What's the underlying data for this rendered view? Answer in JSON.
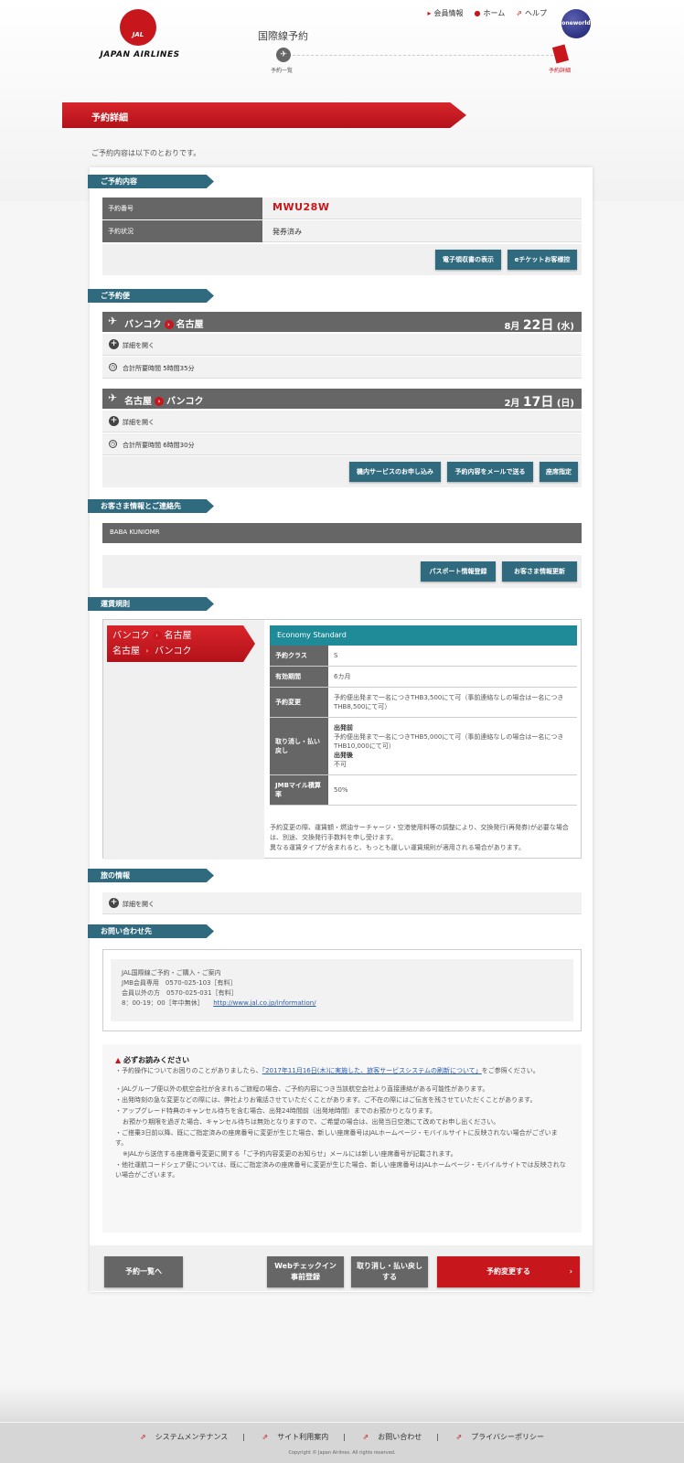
{
  "header": {
    "brand": "JAPAN AIRLINES",
    "brand_mark": "JAL",
    "links": [
      "会員情報",
      "ホーム",
      "ヘルプ"
    ],
    "oneworld": "oneworld",
    "nav_title": "国際線予約",
    "step1_label": "予約一覧",
    "step2_label": "予約詳細"
  },
  "page": {
    "title": "予約詳細",
    "intro": "ご予約内容は以下のとおりです。"
  },
  "reservation": {
    "section": "ご予約内容",
    "rows": [
      {
        "label": "予約番号",
        "value": "MWU28W"
      },
      {
        "label": "予約状況",
        "value": "発券済み"
      }
    ],
    "btn_receipt": "電子領収書の表示",
    "btn_eticket": "eチケットお客様控"
  },
  "flights": {
    "section": "ご予約便",
    "items": [
      {
        "from": "バンコク",
        "to": "名古屋",
        "month": "8月",
        "day": "22日",
        "dow": "(水)",
        "details": "詳細を開く",
        "duration": "合計所要時間 5時間35分"
      },
      {
        "from": "名古屋",
        "to": "バンコク",
        "month": "2月",
        "day": "17日",
        "dow": "(日)",
        "details": "詳細を開く",
        "duration": "合計所要時間 6時間30分"
      }
    ],
    "btn_service": "機内サービスのお申し込み",
    "btn_mail": "予約内容をメールで送る",
    "btn_seat": "座席指定"
  },
  "passenger": {
    "section": "お客さま情報とご連絡先",
    "name": "BABA KUNIOMR",
    "btn_passport": "パスポート情報登録",
    "btn_update": "お客さま情報更新"
  },
  "fare": {
    "section": "運賃規則",
    "route1_from": "バンコク",
    "route1_to": "名古屋",
    "route2_from": "名古屋",
    "route2_to": "バンコク",
    "fare_name": "Economy Standard",
    "rows": [
      {
        "k": "予約クラス",
        "v": "S"
      },
      {
        "k": "有効期間",
        "v": "6カ月"
      },
      {
        "k": "予約変更",
        "v": "予約便出発まで一名につきTHB3,500にて可（事前連絡なしの場合は一名につきTHB8,500にて可）"
      },
      {
        "k": "JMBマイル積算率",
        "v": "50%"
      }
    ],
    "cancel_k": "取り消し・払い戻し",
    "cancel_before_h": "出発前",
    "cancel_before": "予約便出発まで一名につきTHB5,000にて可（事前連絡なしの場合は一名につきTHB10,000にて可）",
    "cancel_after_h": "出発後",
    "cancel_after": "不可",
    "note1": "予約変更の際、運賃額・燃油サーチャージ・空港使用料等の調整により、交換発行(再発券)が必要な場合は、別途、交換発行手数料を申し受けます。",
    "note2": "異なる運賃タイプが含まれると、もっとも厳しい運賃規則が適用される場合があります。"
  },
  "travel": {
    "section": "旅の情報",
    "details": "詳細を開く"
  },
  "inquiry": {
    "section": "お問い合わせ先",
    "line1": "JAL国際線ご予約・ご購入・ご案内",
    "line2": "JMB会員専用　0570-025-103［有料］",
    "line3": "会員以外の方　0570-025-031［有料］",
    "hours": "8：00-19：00［年中無休］",
    "url": "http://www.jal.co.jp/information/"
  },
  "notice": {
    "title": "必ずお読みください",
    "p1a": "・予約操作についてお困りのことがありましたら、",
    "p1link": "「2017年11月16日(木)に実施した、旅客サービスシステムの刷新について」",
    "p1b": "をご参照ください。",
    "p2": "・JALグループ便以外の航空会社が含まれるご旅程の場合、ご予約内容につき当該航空会社より直接連絡がある可能性があります。",
    "p3": "・出発時刻の急な変更などの際には、弊社よりお電話させていただくことがあります。ご不在の際にはご伝言を残させていただくことがあります。",
    "p4": "・アップグレード特典のキャンセル待ちを含む場合、出発24時間前（出発地時間）までのお預かりとなります。",
    "p4b": "お預かり期限を過ぎた場合、キャンセル待ちは無効となりますので、ご希望の場合は、出発当日空港にて改めてお申し出ください。",
    "p5": "・ご搭乗3日前以降、既にご指定済みの座席番号に変更が生じた場合、新しい座席番号はJALホームページ・モバイルサイトに反映されない場合がございます。",
    "p5b": "※JALから送信する座席番号変更に関する「ご予約内容変更のお知らせ」メールには新しい座席番号が記載されます。",
    "p6": "・他社運航コードシェア便については、既にご指定済みの座席番号に変更が生じた場合、新しい座席番号はJALホームページ・モバイルサイトでは反映されない場合がございます。"
  },
  "actions": {
    "back": "予約一覧へ",
    "checkin1": "Webチェックイン",
    "checkin2": "事前登録",
    "cancel1": "取り消し・払い戻し",
    "cancel2": "する",
    "change": "予約変更する"
  },
  "footer": {
    "links": [
      "システムメンテナンス",
      "サイト利用案内",
      "お問い合わせ",
      "プライバシーポリシー"
    ],
    "copyright": "Copyright © Japan Airlines. All rights reserved."
  },
  "colors": {
    "brand_red": "#c8161d",
    "section_teal": "#2f6a7e",
    "fare_teal": "#1f8b99",
    "dark_gray": "#666666"
  }
}
